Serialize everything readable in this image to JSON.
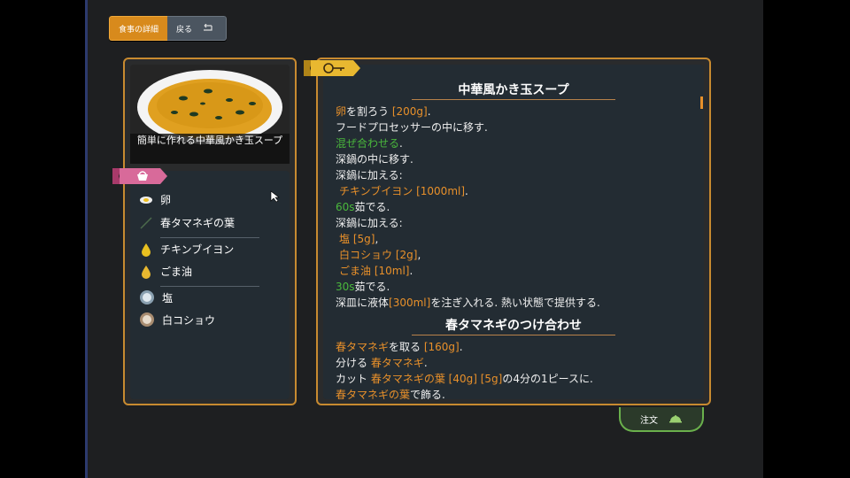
{
  "tabs": {
    "details": "食事の詳細",
    "back": "戻る"
  },
  "dish": {
    "caption": "簡単に作れる中華風かき玉スープ"
  },
  "ingredients": {
    "group1": [
      "卵",
      "春タマネギの葉"
    ],
    "group2": [
      "チキンブイヨン",
      "ごま油"
    ],
    "group3": [
      "塩",
      "白コショウ"
    ]
  },
  "recipe": {
    "title1": "中華風かき玉スープ",
    "title2": "春タマネギのつけ合わせ",
    "lines": [
      [
        "卵",
        "を割ろう ",
        "[200g]",
        "."
      ],
      [
        "フードプロセッサーの中に移す."
      ],
      [
        "混ぜ合わせる",
        "."
      ],
      [
        "深鍋の中に移す."
      ],
      [
        "深鍋に加える:"
      ],
      [
        "チキンブイヨン [1000ml]",
        "."
      ],
      [
        "60s",
        "茹でる."
      ],
      [
        "深鍋に加える:"
      ],
      [
        "塩 [5g]",
        ","
      ],
      [
        "白コショウ [2g]",
        ","
      ],
      [
        "ごま油 [10ml]",
        "."
      ],
      [
        "30s",
        "茹でる."
      ],
      [
        "深皿に液体",
        "[300ml]",
        "を注ぎ入れる. 熱い状態で提供する."
      ]
    ],
    "lines2": [
      [
        "春タマネギ",
        "を取る ",
        "[160g]",
        "."
      ],
      [
        "分ける ",
        "春タマネギ",
        "."
      ],
      [
        "カット ",
        "春タマネギの葉 [40g] [5g]",
        "の4分の1ピースに."
      ],
      [
        "春タマネギの葉",
        "で飾る."
      ]
    ]
  },
  "order": {
    "label": "注文"
  },
  "colors": {
    "accent": "#d88a1c",
    "frame": "#c88a30",
    "green": "#4ab83c"
  }
}
